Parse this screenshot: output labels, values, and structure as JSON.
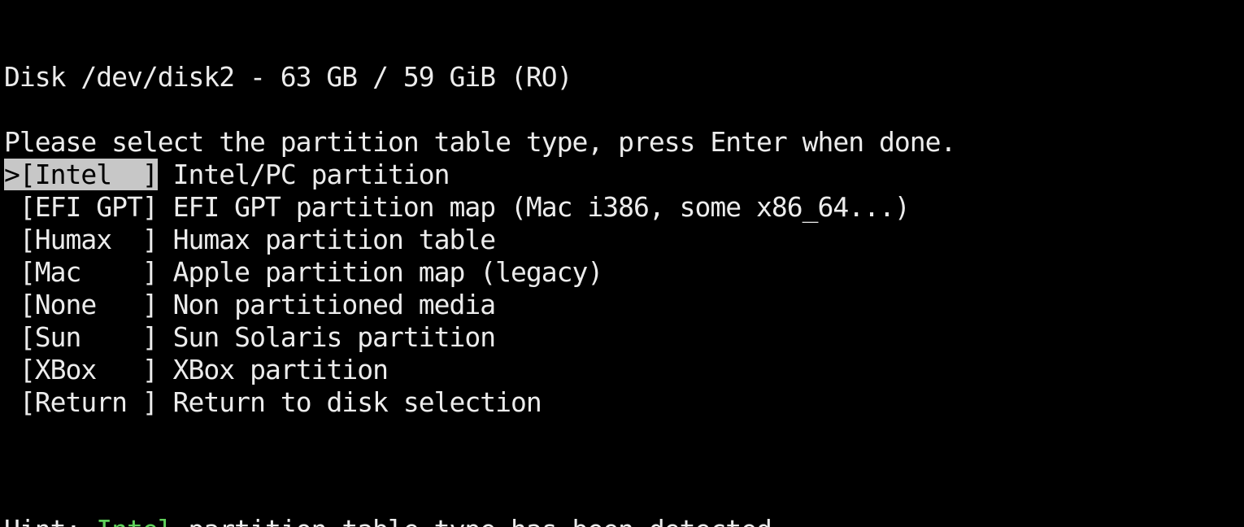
{
  "disk_header": "Disk /dev/disk2 - 63 GB / 59 GiB (RO)",
  "prompt": "Please select the partition table type, press Enter when done.",
  "selected_index": 0,
  "options": [
    {
      "marker": ">",
      "key": "[Intel  ]",
      "description": " Intel/PC partition"
    },
    {
      "marker": " ",
      "key": "[EFI GPT]",
      "description": " EFI GPT partition map (Mac i386, some x86_64...)"
    },
    {
      "marker": " ",
      "key": "[Humax  ]",
      "description": " Humax partition table"
    },
    {
      "marker": " ",
      "key": "[Mac    ]",
      "description": " Apple partition map (legacy)"
    },
    {
      "marker": " ",
      "key": "[None   ]",
      "description": " Non partitioned media"
    },
    {
      "marker": " ",
      "key": "[Sun    ]",
      "description": " Sun Solaris partition"
    },
    {
      "marker": " ",
      "key": "[XBox   ]",
      "description": " XBox partition"
    },
    {
      "marker": " ",
      "key": "[Return ]",
      "description": " Return to disk selection"
    }
  ],
  "hint": {
    "prefix": "Hint: ",
    "type": "Intel",
    "suffix": " partition table type has been detected."
  },
  "colors": {
    "background": "#000000",
    "foreground": "#ececec",
    "selection_bg": "#c7c7c7",
    "hint_highlight": "#5fd05a"
  }
}
